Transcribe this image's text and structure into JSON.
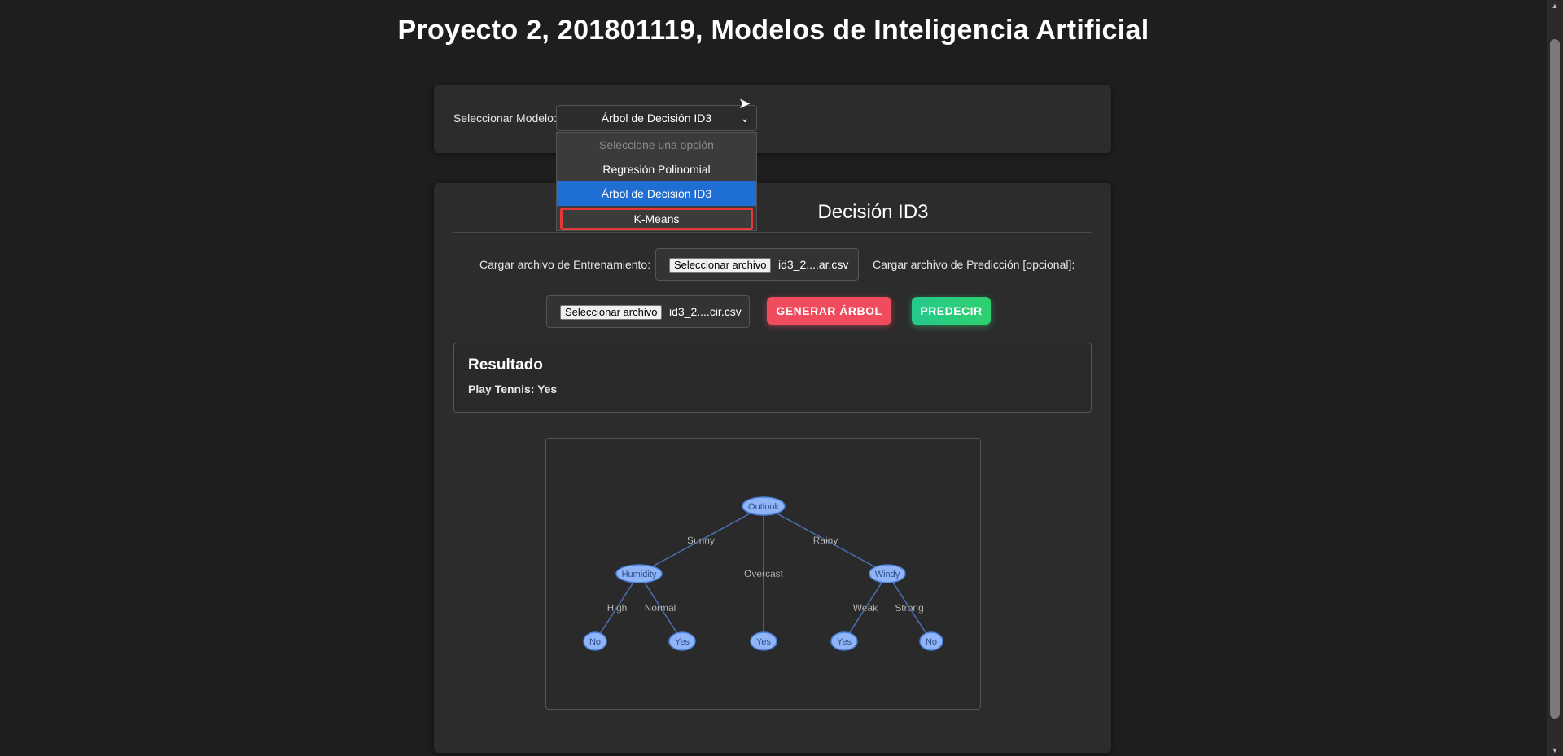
{
  "header": {
    "title": "Proyecto 2, 201801119, Modelos de Inteligencia Artificial"
  },
  "model_select": {
    "label": "Seleccionar Modelo:",
    "selected": "Árbol de Decisión ID3",
    "options": [
      {
        "label": "Seleccione una opción",
        "state": "disabled"
      },
      {
        "label": "Regresión Polinomial",
        "state": "normal"
      },
      {
        "label": "Árbol de Decisión ID3",
        "state": "selected"
      },
      {
        "label": "K-Means",
        "state": "highlight"
      }
    ]
  },
  "main": {
    "heading_visible": "Decisión ID3",
    "train_label": "Cargar archivo de Entrenamiento:",
    "train_button": "Seleccionar archivo",
    "train_file": "id3_2....ar.csv",
    "predict_label": "Cargar archivo de Predicción [opcional]:",
    "predict_button": "Seleccionar archivo",
    "predict_file": "id3_2....cir.csv",
    "generate_button": "GENERAR ÁRBOL",
    "predict_action": "PREDECIR"
  },
  "result": {
    "title": "Resultado",
    "text": "Play Tennis: Yes"
  },
  "tree": {
    "nodes": [
      "Outlook",
      "Humidity",
      "Overcast",
      "Windy",
      "No",
      "Yes",
      "Yes",
      "Yes",
      "No"
    ],
    "edge_labels": [
      "Sunny",
      "Rainy",
      "High",
      "Normal",
      "Weak",
      "Strong"
    ]
  },
  "colors": {
    "node_fill": "#8fb4f8",
    "node_stroke": "#4a7fd6",
    "edge": "#4a6fb0",
    "selected_option": "#1e6ed4",
    "highlight_border": "#e53935",
    "generate": "#f04c5e",
    "predict": "#2fd06f"
  }
}
